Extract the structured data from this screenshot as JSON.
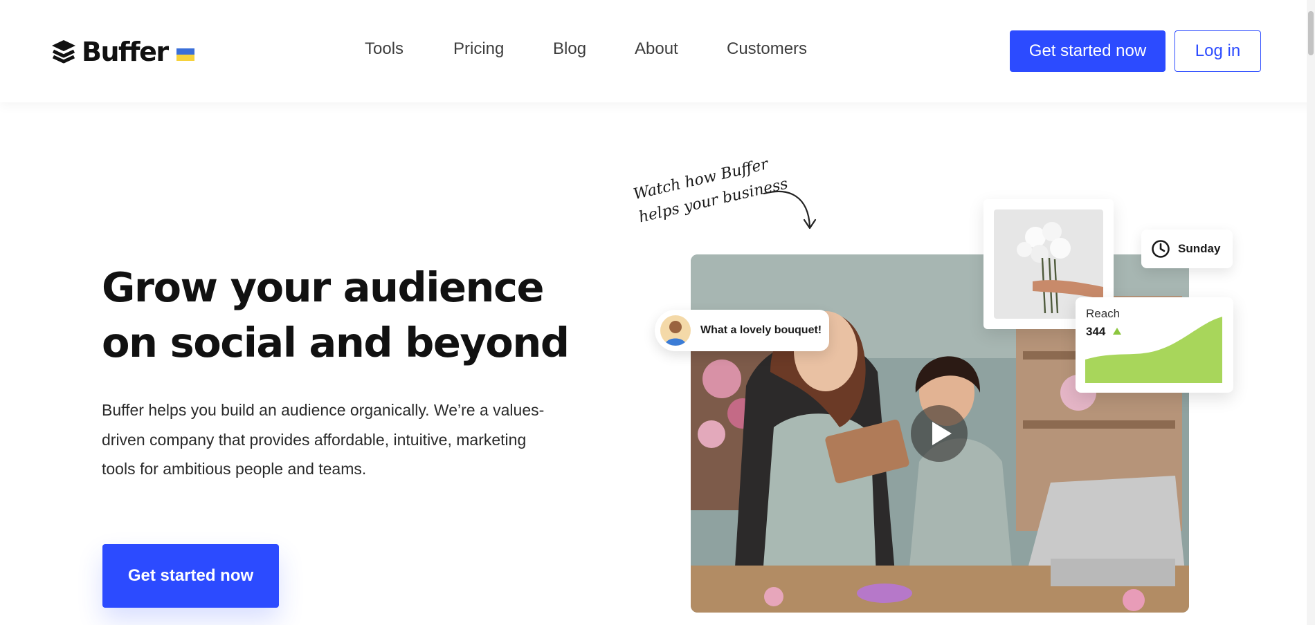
{
  "header": {
    "brand": "Buffer",
    "nav": [
      {
        "label": "Tools"
      },
      {
        "label": "Pricing"
      },
      {
        "label": "Blog"
      },
      {
        "label": "About"
      },
      {
        "label": "Customers"
      }
    ],
    "cta_label": "Get started now",
    "login_label": "Log in"
  },
  "hero": {
    "title_lines": [
      "Grow your audience",
      "on social and beyond"
    ],
    "description_lines": [
      "Buffer helps you build an audience organically. We’re a values-",
      "driven company that provides affordable, intuitive, marketing",
      "tools for ambitious people and teams."
    ],
    "cta_label": "Get started now"
  },
  "media": {
    "note_lines": [
      "Watch how Buffer",
      "helps your business"
    ],
    "comment": "What a lovely bouquet!",
    "day_label": "Sunday",
    "reach_label": "Reach",
    "reach_value": "344",
    "reach_trend": "up",
    "icons": [
      "buffer-logo-icon",
      "ukraine-flag-icon",
      "play-icon",
      "clock-icon",
      "trend-up-icon",
      "curved-arrow-icon"
    ]
  },
  "colors": {
    "primary": "#2c4bff",
    "chart_green": "#a8d65b",
    "text_dark": "#111111"
  }
}
